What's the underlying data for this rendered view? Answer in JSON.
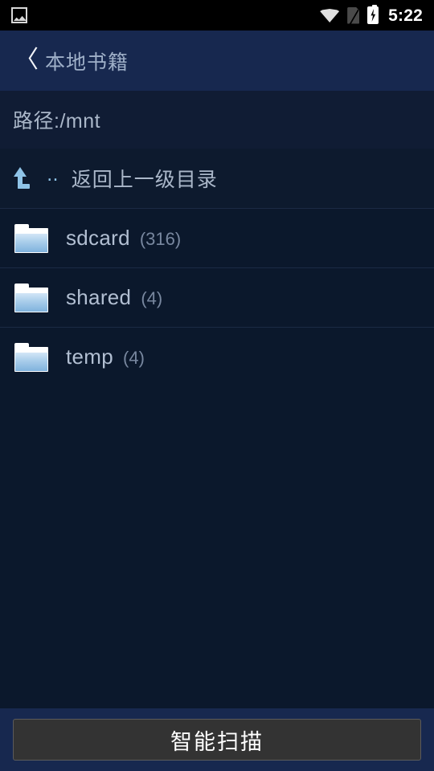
{
  "statusbar": {
    "notification_icon": "photo-icon",
    "wifi_icon": "wifi-icon",
    "sim_icon": "sim-disabled-icon",
    "battery_icon": "battery-charging-icon",
    "time": "5:22"
  },
  "titlebar": {
    "back_icon": "back-chevron-icon",
    "back_glyph": "〈",
    "title": "本地书籍"
  },
  "pathbar": {
    "path_label": "路径:/mnt"
  },
  "list": {
    "updir": {
      "icon": "arrow-up-icon",
      "dots": "‥",
      "label": "返回上一级目录"
    },
    "items": [
      {
        "icon": "folder-icon",
        "name": "sdcard",
        "count": "(316)"
      },
      {
        "icon": "folder-icon",
        "name": "shared",
        "count": "(4)"
      },
      {
        "icon": "folder-icon",
        "name": "temp",
        "count": "(4)"
      }
    ]
  },
  "footer": {
    "scan_label": "智能扫描"
  },
  "colors": {
    "statusbar_bg": "#000000",
    "titlebar_bg": "#17284f",
    "pathbar_bg": "#101c34",
    "list_bg": "#0b182c",
    "divider": "#1b2a44",
    "accent_blue": "#8fc4e8",
    "text_primary": "#b2bfd2",
    "text_secondary": "#78879f",
    "button_bg": "#333333",
    "button_text": "#ffffff"
  }
}
